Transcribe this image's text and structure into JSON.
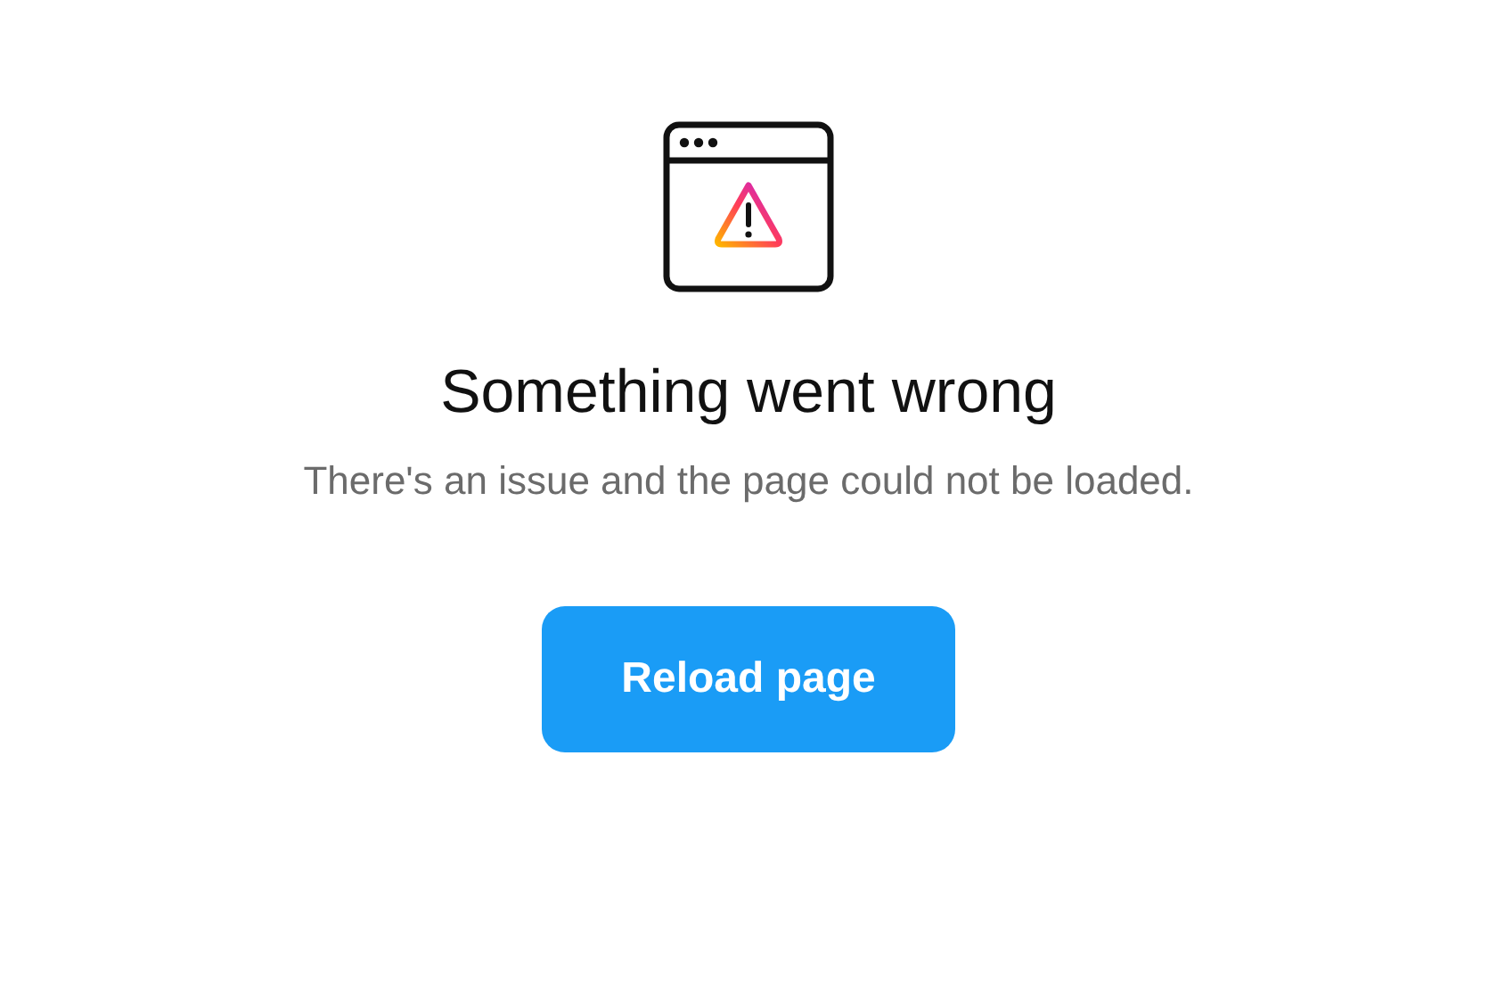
{
  "error": {
    "title": "Something went wrong",
    "message": "There's an issue and the page could not be loaded."
  },
  "buttons": [
    {
      "label": "Reload page"
    }
  ]
}
